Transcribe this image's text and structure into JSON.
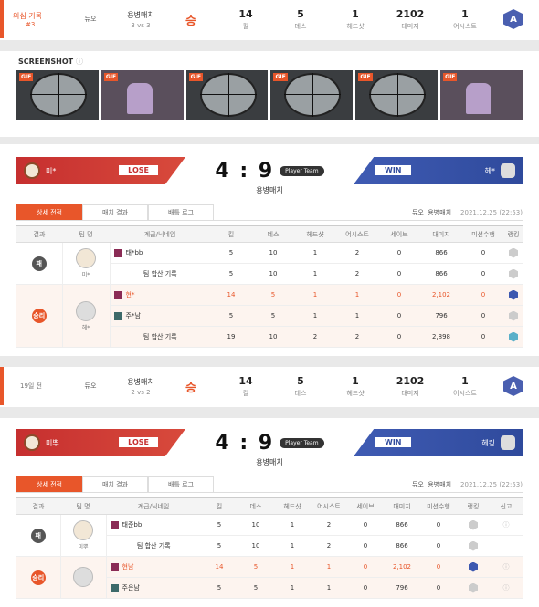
{
  "summary_top": {
    "title": "의심 기록",
    "sub": "#3",
    "mode": "듀오",
    "match": "용병매치",
    "vs": "3 vs 3",
    "result": "승",
    "kill": "14",
    "kill_lbl": "킬",
    "death": "5",
    "death_lbl": "데스",
    "hs": "1",
    "hs_lbl": "헤드샷",
    "dmg": "2102",
    "dmg_lbl": "대미지",
    "assist": "1",
    "assist_lbl": "어시스트",
    "rank": "A"
  },
  "screenshot_label": "SCREENSHOT",
  "gif_label": "GIF",
  "matches": [
    {
      "left_team": "미*",
      "right_team": "헤*",
      "left_result": "LOSE",
      "right_result": "WIN",
      "score": "4 : 9",
      "player_team": "Player Team",
      "mode": "용병매치",
      "tabs": [
        "상세 전적",
        "매치 결과",
        "배틀 로그"
      ],
      "meta_mode": "듀오",
      "meta_match": "용병매치",
      "date": "2021.12.25 (22:53)",
      "headers": [
        "결과",
        "팀 명",
        "계급/닉네임",
        "킬",
        "데스",
        "헤드샷",
        "어시스트",
        "세이브",
        "대미지",
        "미션수행",
        "랭킹"
      ],
      "lose_label": "패",
      "win_label": "승리",
      "lose_team_name": "미*",
      "win_team_name": "헤*",
      "rows_lose": [
        {
          "name": "태*bb",
          "k": "5",
          "d": "10",
          "h": "1",
          "a": "2",
          "s": "0",
          "dmg": "866",
          "m": "0"
        },
        {
          "name": "팀 합산 기록",
          "k": "5",
          "d": "10",
          "h": "1",
          "a": "2",
          "s": "0",
          "dmg": "866",
          "m": "0"
        }
      ],
      "rows_win": [
        {
          "name": "현*",
          "k": "14",
          "d": "5",
          "h": "1",
          "a": "1",
          "s": "0",
          "dmg": "2,102",
          "m": "0"
        },
        {
          "name": "주*남",
          "k": "5",
          "d": "5",
          "h": "1",
          "a": "1",
          "s": "0",
          "dmg": "796",
          "m": "0"
        },
        {
          "name": "팀 합산 기록",
          "k": "19",
          "d": "10",
          "h": "2",
          "a": "2",
          "s": "0",
          "dmg": "2,898",
          "m": "0"
        }
      ]
    },
    {
      "left_team": "미뿌",
      "right_team": "헤킹",
      "left_result": "LOSE",
      "right_result": "WIN",
      "score": "4 : 9",
      "player_team": "Player Team",
      "mode": "용병매치",
      "tabs": [
        "상세 전적",
        "매치 결과",
        "배틀 로그"
      ],
      "meta_mode": "듀오",
      "meta_match": "용병매치",
      "date": "2021.12.25 (22:53)",
      "headers": [
        "결과",
        "팀 명",
        "계급/닉네임",
        "킬",
        "데스",
        "헤드샷",
        "어시스트",
        "세이브",
        "대미지",
        "미션수행",
        "랭킹",
        "신고"
      ],
      "lose_label": "패",
      "win_label": "승리",
      "lose_team_name": "미뿌",
      "rows_lose": [
        {
          "name": "태준bb",
          "k": "5",
          "d": "10",
          "h": "1",
          "a": "2",
          "s": "0",
          "dmg": "866",
          "m": "0"
        },
        {
          "name": "팀 합산 기록",
          "k": "5",
          "d": "10",
          "h": "1",
          "a": "2",
          "s": "0",
          "dmg": "866",
          "m": "0"
        }
      ],
      "rows_win": [
        {
          "name": "현남",
          "k": "14",
          "d": "5",
          "h": "1",
          "a": "1",
          "s": "0",
          "dmg": "2,102",
          "m": "0"
        },
        {
          "name": "주은남",
          "k": "5",
          "d": "5",
          "h": "1",
          "a": "1",
          "s": "0",
          "dmg": "796",
          "m": "0"
        }
      ]
    }
  ],
  "summary_mid": {
    "time": "19일 전",
    "mode": "듀오",
    "match": "용병매치",
    "vs": "2 vs 2",
    "result": "승",
    "kill": "14",
    "kill_lbl": "킬",
    "death": "5",
    "death_lbl": "데스",
    "hs": "1",
    "hs_lbl": "헤드샷",
    "dmg": "2102",
    "dmg_lbl": "대미지",
    "assist": "1",
    "assist_lbl": "어시스트",
    "rank": "A"
  }
}
